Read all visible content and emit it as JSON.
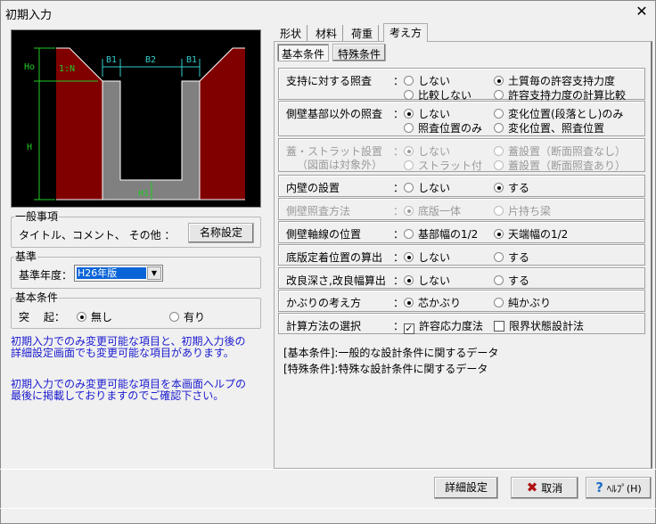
{
  "window": {
    "title": "初期入力",
    "close": "✕"
  },
  "diagram": {
    "labels": {
      "ho": "Ho",
      "slope": "1:N",
      "h": "H",
      "b1_left": "B1",
      "b2": "B2",
      "b1_right": "B1",
      "h1": "H1"
    },
    "colors": {
      "soil": "#800000",
      "concrete": "#808080",
      "dim_green": "#22cc22",
      "dim_cyan": "#33cccc"
    }
  },
  "general": {
    "legend": "一般事項",
    "label": "タイトル、コメント、 その他 ：",
    "button": "名称設定"
  },
  "standard": {
    "legend": "基準",
    "label": "基準年度：",
    "selected": "H26年版",
    "arrow": "▼"
  },
  "basic": {
    "legend": "基本条件",
    "label": "突　 起：",
    "options": [
      {
        "label": "無し",
        "checked": true
      },
      {
        "label": "有り",
        "checked": false
      }
    ]
  },
  "notes": [
    "初期入力でのみ変更可能な項目と、初期入力後の",
    "詳細設定画面でも変更可能な項目があります。",
    "初期入力でのみ変更可能な項目を本画面ヘルプの",
    "最後に掲載しておりますのでご確認下さい。"
  ],
  "tabs": [
    {
      "label": "形状"
    },
    {
      "label": "材料"
    },
    {
      "label": "荷重"
    },
    {
      "label": "考え方",
      "active": true
    }
  ],
  "subtabs": [
    {
      "label": "基本条件",
      "active": true
    },
    {
      "label": "特殊条件"
    }
  ],
  "rows": [
    {
      "label": "支持に対する照査",
      "colon": "：",
      "options": [
        "しない",
        "土質毎の許容支持力度",
        "比較しない",
        "許容支持力度の計算比較"
      ],
      "checked": 1
    },
    {
      "label": "側壁基部以外の照査",
      "colon": "：",
      "options": [
        "しない",
        "変化位置(段落とし)のみ",
        "照査位置のみ",
        "変化位置、照査位置"
      ],
      "checked": 0
    },
    {
      "label": "蓋・ストラット設置",
      "sublabel": "（図面は対象外）",
      "colon": "：",
      "options": [
        "しない",
        "蓋設置（断面照査なし）",
        "ストラット付",
        "蓋設置（断面照査あり）"
      ],
      "checked": 0,
      "disabled": true
    },
    {
      "label": "内壁の設置",
      "colon": "：",
      "options": [
        "しない",
        "する"
      ],
      "checked": 1
    },
    {
      "label": "側壁照査方法",
      "colon": "：",
      "options": [
        "底版一体",
        "片持ち梁"
      ],
      "checked": 0,
      "disabled": true
    },
    {
      "label": "側壁軸線の位置",
      "colon": "：",
      "options": [
        "基部幅の1/2",
        "天端幅の1/2"
      ],
      "checked": 1
    },
    {
      "label": "底版定着位置の算出",
      "colon": "：",
      "options": [
        "しない",
        "する"
      ],
      "checked": 0
    },
    {
      "label": "改良深さ,改良幅算出",
      "colon": "：",
      "options": [
        "しない",
        "する"
      ],
      "checked": 0
    },
    {
      "label": "かぶりの考え方",
      "colon": "：",
      "options": [
        "芯かぶり",
        "純かぶり"
      ],
      "checked": 0
    },
    {
      "label": "計算方法の選択",
      "colon": "：",
      "checkboxes": [
        {
          "label": "許容応力度法",
          "checked": true
        },
        {
          "label": "限界状態設計法",
          "checked": false
        }
      ]
    }
  ],
  "footnotes": [
    "[基本条件]:一般的な設計条件に関するデータ",
    "[特殊条件]:特殊な設計条件に関するデータ"
  ],
  "buttons": {
    "detail": "詳細設定",
    "cancel": "取消",
    "help": "ﾍﾙﾌﾟ(H)",
    "cancel_icon": "✖",
    "help_icon": "?"
  }
}
